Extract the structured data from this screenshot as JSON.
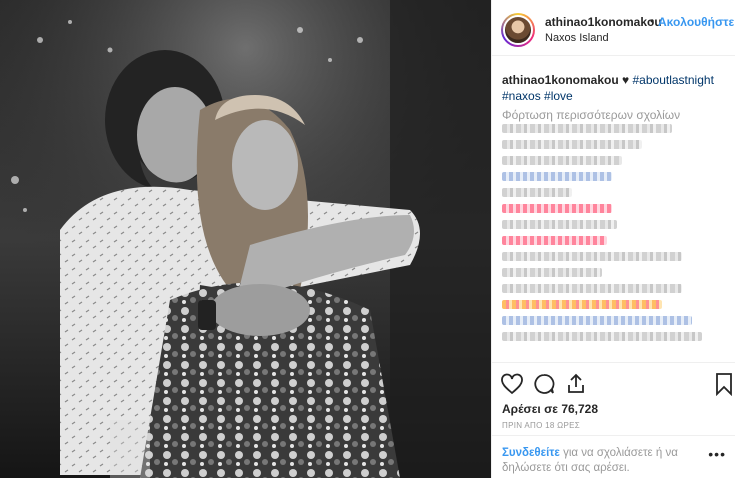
{
  "header": {
    "username": "athinao1konomakou",
    "separator": "•",
    "follow_label": "Ακολουθήστε",
    "location": "Naxos Island"
  },
  "caption": {
    "username": "athinao1konomakou",
    "heart": "♥",
    "tags": [
      "#aboutlastnight",
      "#naxos",
      "#love"
    ]
  },
  "load_more_label": "Φόρτωση περισσότερων σχολίων",
  "actions": {
    "icons": [
      "heart-icon",
      "comment-icon",
      "share-icon",
      "bookmark-icon"
    ]
  },
  "likes_label": "Αρέσει σε 76,728",
  "timestamp": "ΠΡΙΝ ΑΠΟ 18 ΩΡΕΣ",
  "footer": {
    "login_link": "Συνδεθείτε",
    "login_text": " για να σχολιάσετε ή να δηλώσετε ότι σας αρέσει.",
    "more_label": "•••"
  },
  "colors": {
    "link": "#3897f0",
    "hashtag": "#003569",
    "muted": "#999999",
    "text": "#262626"
  }
}
